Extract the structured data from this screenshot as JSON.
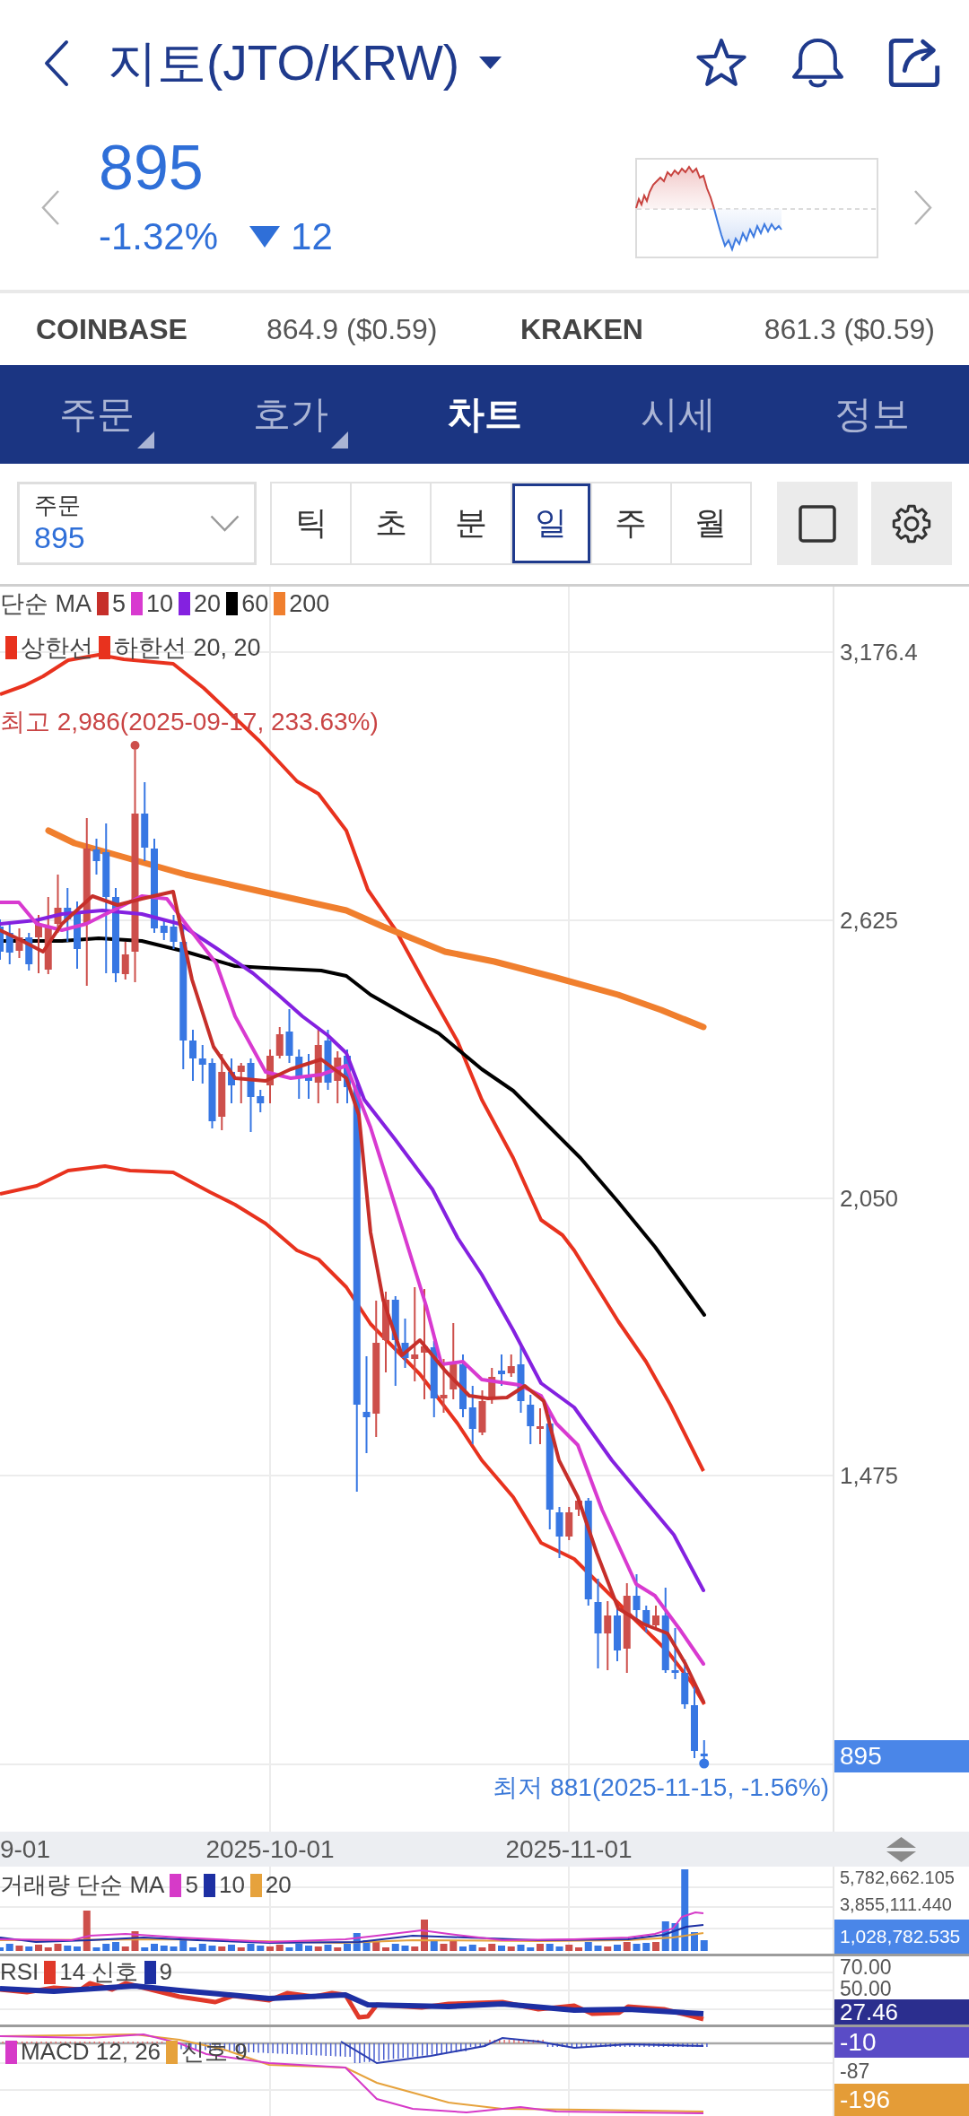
{
  "header": {
    "title": "지토(JTO/KRW)"
  },
  "quote": {
    "price": "895",
    "change_percent": "-1.32%",
    "change_amount": "12",
    "falling": true
  },
  "exchanges": [
    {
      "name": "COINBASE",
      "price": "864.9 ($0.59)"
    },
    {
      "name": "KRAKEN",
      "price": "861.3 ($0.59)"
    }
  ],
  "tabs": [
    {
      "label": "주문",
      "selected": false,
      "has_menu": true
    },
    {
      "label": "호가",
      "selected": false,
      "has_menu": true
    },
    {
      "label": "차트",
      "selected": true,
      "has_menu": false
    },
    {
      "label": "시세",
      "selected": false,
      "has_menu": false
    },
    {
      "label": "정보",
      "selected": false,
      "has_menu": false
    }
  ],
  "order_select": {
    "label": "주문",
    "value": "895"
  },
  "periods": [
    {
      "label": "틱",
      "selected": false
    },
    {
      "label": "초",
      "selected": false
    },
    {
      "label": "분",
      "selected": false
    },
    {
      "label": "일",
      "selected": true
    },
    {
      "label": "주",
      "selected": false
    },
    {
      "label": "월",
      "selected": false
    }
  ],
  "price_chart": {
    "legends": [
      {
        "label": "단순 MA",
        "items": [
          {
            "label": "5",
            "color": "#c62f2a"
          },
          {
            "label": "10",
            "color": "#d83ad0"
          },
          {
            "label": "20",
            "color": "#8421e0"
          },
          {
            "label": "60",
            "color": "#000000"
          },
          {
            "label": "200",
            "color": "#f07f2e"
          }
        ]
      },
      {
        "items": [
          {
            "label": "상한선",
            "color": "#e8321e"
          },
          {
            "label": "하한선 20, 20",
            "color": "#e8321e"
          }
        ]
      }
    ],
    "axis_labels": [
      "3,176.4",
      "2,625",
      "2,050",
      "1,475"
    ],
    "price_tag": {
      "text": "895",
      "color": "#4a86e8"
    },
    "high_label": "최고 2,986(2025-09-17, 233.63%)",
    "low_label": "최저 881(2025-11-15, -1.56%)"
  },
  "date_axis": [
    "9-01",
    "2025-10-01",
    "2025-11-01"
  ],
  "volume": {
    "legend": {
      "label": "거래량 단순 MA",
      "items": [
        {
          "label": "5",
          "color": "#d63ac8"
        },
        {
          "label": "10",
          "color": "#1d2fa3"
        },
        {
          "label": "20",
          "color": "#e6a23c"
        }
      ]
    },
    "axis": [
      {
        "kind": "label",
        "text": "5,782,662.105"
      },
      {
        "kind": "label",
        "text": "3,855,111.440"
      },
      {
        "kind": "tag",
        "text": "1,028,782.535",
        "color": "#4a86e8"
      }
    ]
  },
  "rsi": {
    "legend": {
      "label": "RSI",
      "items": [
        {
          "label": "14 신호",
          "color": "#e0392a"
        },
        {
          "label": "9",
          "color": "#1d2fa3"
        }
      ]
    },
    "axis": [
      {
        "kind": "label",
        "text": "70.00"
      },
      {
        "kind": "label",
        "text": "50.00"
      },
      {
        "kind": "tag",
        "text": "27.46",
        "color": "#2b2e8e"
      }
    ]
  },
  "macd": {
    "legend": {
      "items": [
        {
          "label": "MACD 12, 26",
          "color": "#d63ac8"
        },
        {
          "label": "신호 9",
          "color": "#e6a23c"
        }
      ]
    },
    "axis": [
      {
        "kind": "tag",
        "text": "-10",
        "color": "#5a4cc6"
      },
      {
        "kind": "label",
        "text": "-87"
      },
      {
        "kind": "tag",
        "text": "-196",
        "color": "#e49c37"
      }
    ]
  }
}
